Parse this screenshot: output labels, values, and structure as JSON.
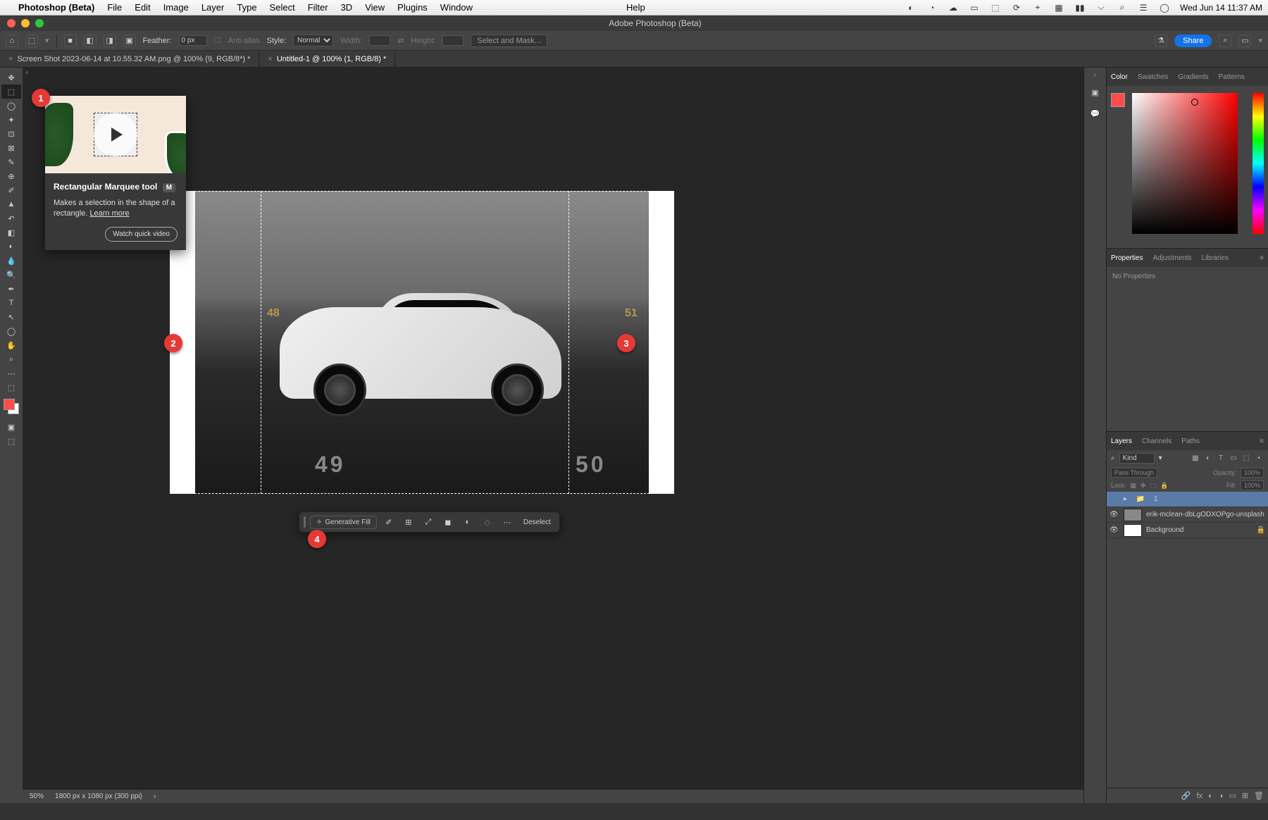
{
  "menubar": {
    "app_name": "Photoshop (Beta)",
    "items": [
      "File",
      "Edit",
      "Image",
      "Layer",
      "Type",
      "Select",
      "Filter",
      "3D",
      "View",
      "Plugins",
      "Window"
    ],
    "help": "Help",
    "datetime": "Wed Jun 14  11:37 AM"
  },
  "window_title": "Adobe Photoshop (Beta)",
  "options_bar": {
    "feather_label": "Feather:",
    "feather_value": "0 px",
    "anti_alias": "Anti-alias",
    "style_label": "Style:",
    "style_value": "Normal",
    "width_label": "Width:",
    "height_label": "Height:",
    "select_mask": "Select and Mask...",
    "share": "Share"
  },
  "tabs": [
    "Screen Shot 2023-06-14 at 10.55.32 AM.png @ 100% (9, RGB/8*) *",
    "Untitled-1 @ 100% (1, RGB/8) *"
  ],
  "tooltip": {
    "title": "Rectangular Marquee tool",
    "shortcut": "M",
    "desc": "Makes a selection in the shape of a rectangle.",
    "learn_more": "Learn more",
    "watch": "Watch quick video"
  },
  "parking": {
    "n1": "48",
    "n2": "49",
    "n3": "51",
    "floor1": "49",
    "floor2": "50"
  },
  "context_bar": {
    "generative_fill": "Generative Fill",
    "deselect": "Deselect"
  },
  "statusbar": {
    "zoom": "50%",
    "dims": "1800 px x 1080 px (300 ppi)"
  },
  "color_tabs": [
    "Color",
    "Swatches",
    "Gradients",
    "Patterns"
  ],
  "props_tabs": [
    "Properties",
    "Adjustments",
    "Libraries"
  ],
  "props_body": "No Properties",
  "layers_tabs": [
    "Layers",
    "Channels",
    "Paths"
  ],
  "layers": {
    "kind": "Kind",
    "blend": "Pass Through",
    "opacity_label": "Opacity:",
    "opacity_val": "100%",
    "lock_label": "Lock:",
    "fill_label": "Fill:",
    "fill_val": "100%",
    "items": [
      {
        "name": "1",
        "type": "group"
      },
      {
        "name": "erik-mclean-dbLgODXOPgo-unsplash",
        "type": "image"
      },
      {
        "name": "Background",
        "type": "bg"
      }
    ]
  },
  "annotations": {
    "a1": "1",
    "a2": "2",
    "a3": "3",
    "a4": "4"
  }
}
